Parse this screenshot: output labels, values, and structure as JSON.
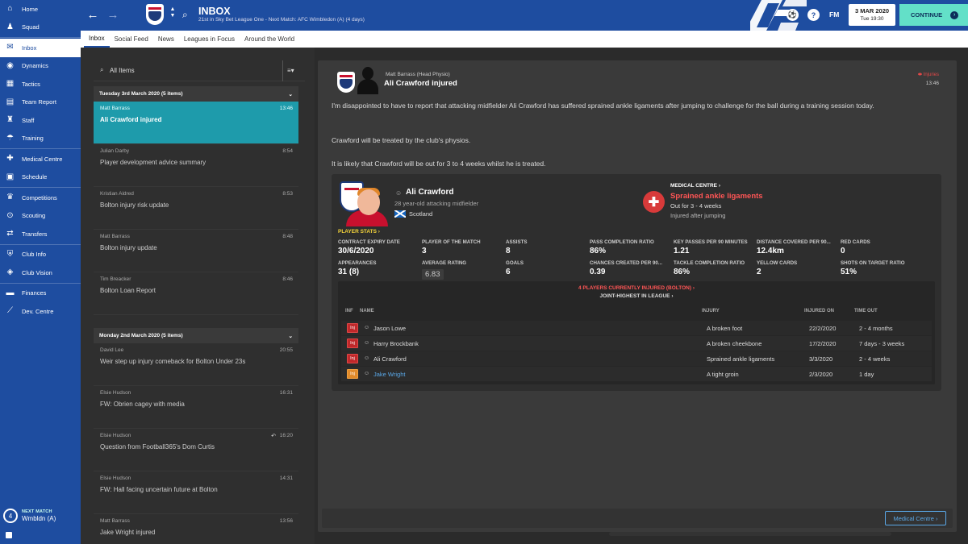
{
  "sidebar": {
    "items": [
      {
        "label": "Home",
        "icon": "home-icon",
        "glyph": "⌂"
      },
      {
        "label": "Squad",
        "icon": "squad-icon",
        "glyph": "♟"
      },
      {
        "label": "Inbox",
        "icon": "inbox-icon",
        "glyph": "✉",
        "active": true
      },
      {
        "label": "Dynamics",
        "icon": "dynamics-icon",
        "glyph": "◉"
      },
      {
        "label": "Tactics",
        "icon": "tactics-icon",
        "glyph": "▦"
      },
      {
        "label": "Team Report",
        "icon": "report-icon",
        "glyph": "▤"
      },
      {
        "label": "Staff",
        "icon": "staff-icon",
        "glyph": "♜"
      },
      {
        "label": "Training",
        "icon": "training-icon",
        "glyph": "☂"
      },
      {
        "label": "Medical Centre",
        "icon": "medical-icon",
        "glyph": "✚"
      },
      {
        "label": "Schedule",
        "icon": "schedule-icon",
        "glyph": "▣"
      },
      {
        "label": "Competitions",
        "icon": "trophy-icon",
        "glyph": "♛"
      },
      {
        "label": "Scouting",
        "icon": "scouting-icon",
        "glyph": "⊙"
      },
      {
        "label": "Transfers",
        "icon": "transfers-icon",
        "glyph": "⇄"
      },
      {
        "label": "Club Info",
        "icon": "club-info-icon",
        "glyph": "⛨"
      },
      {
        "label": "Club Vision",
        "icon": "vision-icon",
        "glyph": "◈"
      },
      {
        "label": "Finances",
        "icon": "finances-icon",
        "glyph": "▬"
      },
      {
        "label": "Dev. Centre",
        "icon": "dev-centre-icon",
        "glyph": "⟋"
      }
    ],
    "next_match": {
      "label": "NEXT MATCH",
      "opponent": "Wmbldn (A)",
      "position": "4"
    }
  },
  "topbar": {
    "title": "INBOX",
    "subtitle": "21st in Sky Bet League One - Next Match: AFC Wimbledon (A) (4 days)",
    "fm_label": "FM",
    "date": "3 MAR 2020",
    "time": "Tue 19:30",
    "continue_label": "CONTINUE"
  },
  "subtabs": [
    "Inbox",
    "Social Feed",
    "News",
    "Leagues in Focus",
    "Around the World"
  ],
  "inbox": {
    "filter": "All Items",
    "groups": [
      {
        "header": "Tuesday 3rd March 2020 (5 items)",
        "messages": [
          {
            "from": "Matt Barrass",
            "time": "13:46",
            "subject": "Ali Crawford injured",
            "active": true
          },
          {
            "from": "Julian Darby",
            "time": "8:54",
            "subject": "Player development advice summary"
          },
          {
            "from": "Kristian Aldred",
            "time": "8:53",
            "subject": "Bolton injury risk update"
          },
          {
            "from": "Matt Barrass",
            "time": "8:48",
            "subject": "Bolton injury update"
          },
          {
            "from": "Tim Breacker",
            "time": "8:46",
            "subject": "Bolton Loan Report"
          }
        ]
      },
      {
        "header": "Monday 2nd March 2020 (5 items)",
        "messages": [
          {
            "from": "David Lee",
            "time": "20:55",
            "subject": "Weir step up injury comeback for Bolton Under 23s"
          },
          {
            "from": "Elsie Hudson",
            "time": "16:31",
            "subject": "FW: Obrien cagey with media"
          },
          {
            "from": "Elsie Hudson",
            "time": "16:20",
            "subject": "Question from Football365's Dom Curtis",
            "replied": true
          },
          {
            "from": "Elsie Hudson",
            "time": "14:31",
            "subject": "FW: Hall facing uncertain future at Bolton"
          },
          {
            "from": "Matt Barrass",
            "time": "13:56",
            "subject": "Jake Wright injured"
          }
        ]
      }
    ]
  },
  "message": {
    "sender": "Matt Barrass  (Head Physio)",
    "subject": "Ali Crawford injured",
    "category": "Injuries",
    "time": "13:46",
    "paragraphs": [
      "I'm disappointed to have to report that attacking midfielder Ali Crawford has suffered sprained ankle ligaments after jumping to challenge for the ball during a training session today.",
      "Crawford will be treated by the club's physios.",
      "It is likely that Crawford will be out for 3 to 4 weeks whilst he is treated."
    ],
    "player": {
      "name": "Ali Crawford",
      "description": "28 year-old attacking midfielder",
      "nationality": "Scotland"
    },
    "medical": {
      "link": "MEDICAL CENTRE",
      "injury": "Sprained ankle ligaments",
      "out_for": "Out for 3 - 4 weeks",
      "how": "Injured after jumping"
    },
    "stats_label": "PLAYER STATS",
    "stats": [
      {
        "label": "CONTRACT EXPIRY DATE",
        "value": "30/6/2020"
      },
      {
        "label": "PLAYER OF THE MATCH",
        "value": "3"
      },
      {
        "label": "ASSISTS",
        "value": "8"
      },
      {
        "label": "PASS COMPLETION RATIO",
        "value": "86%"
      },
      {
        "label": "KEY PASSES PER 90 MINUTES",
        "value": "1.21"
      },
      {
        "label": "DISTANCE COVERED PER 90...",
        "value": "12.4km"
      },
      {
        "label": "RED CARDS",
        "value": "0"
      },
      {
        "label": "APPEARANCES",
        "value": "31 (8)"
      },
      {
        "label": "AVERAGE RATING",
        "value": "6.83"
      },
      {
        "label": "GOALS",
        "value": "6"
      },
      {
        "label": "CHANCES CREATED PER 90...",
        "value": "0.39"
      },
      {
        "label": "TACKLE COMPLETION RATIO",
        "value": "86%"
      },
      {
        "label": "YELLOW CARDS",
        "value": "2"
      },
      {
        "label": "SHOTS ON TARGET RATIO",
        "value": "51%"
      }
    ],
    "injuries": {
      "count_label": "4 PLAYERS CURRENTLY INJURED (BOLTON)",
      "rank_label": "JOINT-HIGHEST IN LEAGUE",
      "headers": {
        "inf": "INF",
        "name": "NAME",
        "injury": "INJURY",
        "injured_on": "INJURED ON",
        "time_out": "TIME OUT"
      },
      "rows": [
        {
          "badge": "Inj",
          "name": "Jason Lowe",
          "injury": "A broken foot",
          "injured_on": "22/2/2020",
          "time_out": "2 - 4 months"
        },
        {
          "badge": "Inj",
          "name": "Harry Brockbank",
          "injury": "A broken cheekbone",
          "injured_on": "17/2/2020",
          "time_out": "7 days - 3 weeks"
        },
        {
          "badge": "Inj",
          "name": "Ali Crawford",
          "injury": "Sprained ankle ligaments",
          "injured_on": "3/3/2020",
          "time_out": "2 - 4 weeks"
        },
        {
          "badge": "Inj",
          "name": "Jake Wright",
          "injury": "A tight groin",
          "injured_on": "2/3/2020",
          "time_out": "1 day",
          "minor": true
        }
      ]
    },
    "footer_button": "Medical Centre"
  }
}
